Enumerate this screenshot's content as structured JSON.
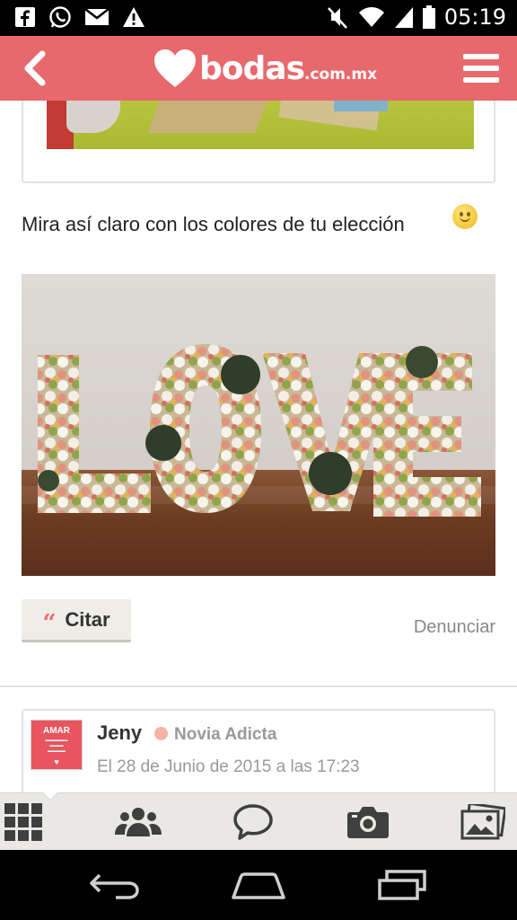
{
  "status_bar": {
    "time": "05:19",
    "left_icons": [
      "facebook-icon",
      "whatsapp-icon",
      "mail-icon",
      "warning-icon"
    ],
    "right_icons": [
      "mute-icon",
      "wifi-icon",
      "signal-icon",
      "battery-icon"
    ]
  },
  "app_bar": {
    "brand": "bodas",
    "brand_suffix": ".com.mx",
    "color": "#e8696d"
  },
  "post": {
    "message": "Mira así claro con los colores de tu elección",
    "photo_word": "LOVE",
    "quote_label": "Citar",
    "report_label": "Denunciar"
  },
  "reply": {
    "avatar_text": "AMAR",
    "author": "Jeny",
    "badge": "Novia Adicta",
    "date": "El 28 de Junio de 2015 a las 17:23"
  },
  "bottom_nav": {
    "tabs": [
      "grid-icon",
      "community-icon",
      "chat-icon",
      "camera-icon",
      "gallery-icon"
    ]
  },
  "system_nav": [
    "back-icon",
    "home-icon",
    "recents-icon"
  ]
}
